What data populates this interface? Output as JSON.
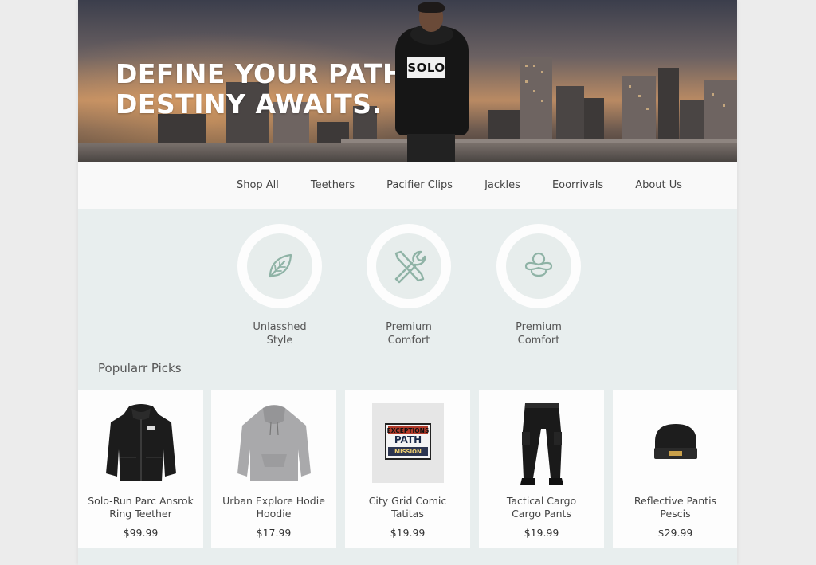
{
  "hero": {
    "title_line1": "DEFINE YOUR PATH.",
    "title_line2": "DESTINY AWAITS.",
    "hoodie_text": "SOLO"
  },
  "nav": {
    "items": [
      "Shop All",
      "Teethers",
      "Pacifier Clips",
      "Jackles",
      "Eoorrivals",
      "About Us"
    ]
  },
  "features": [
    {
      "label_line1": "Unlasshed",
      "label_line2": "Style",
      "icon": "leaf-icon"
    },
    {
      "label_line1": "Premium",
      "label_line2": "Comfort",
      "icon": "tools-icon"
    },
    {
      "label_line1": "Premium",
      "label_line2": "Comfort",
      "icon": "pacifier-icon"
    }
  ],
  "section": {
    "title": "Popularr Picks"
  },
  "products": [
    {
      "name_line1": "Solo-Run Parc Ansrok",
      "name_line2": "Ring Teether",
      "price": "$99.99",
      "image": "jacket"
    },
    {
      "name_line1": "Urban Explore  Hodie",
      "name_line2": "Hoodie",
      "price": "$17.99",
      "image": "hoodie"
    },
    {
      "name_line1": "City Grid Comic",
      "name_line2": "Tatitas",
      "price": "$19.99",
      "image": "poster"
    },
    {
      "name_line1": "Tactical Cargo",
      "name_line2": "Cargo Pants",
      "price": "$19.99",
      "image": "pants"
    },
    {
      "name_line1": "Reflective Pantis",
      "name_line2": "Pescis",
      "price": "$29.99",
      "image": "beanie"
    }
  ],
  "poster": {
    "line1": "EXCEPTIONS",
    "line2": "PATH",
    "line3": "MISSION"
  },
  "colors": {
    "background": "#ececec",
    "page": "#e8eeee",
    "card": "#fdfdfd",
    "icon_stroke": "#8fb3a6",
    "hero_text": "#ffffff"
  }
}
